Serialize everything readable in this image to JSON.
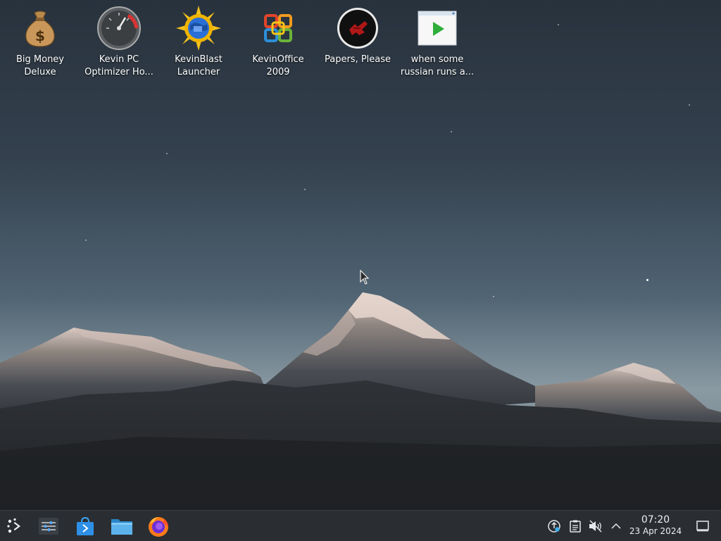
{
  "desktop": {
    "icons": [
      {
        "label": "Big Money\nDeluxe",
        "icon": "money-bag-icon"
      },
      {
        "label": "Kevin PC\nOptimizer Ho...",
        "icon": "speedometer-icon"
      },
      {
        "label": "KevinBlast\nLauncher",
        "icon": "globe-sun-icon"
      },
      {
        "label": "KevinOffice\n2009",
        "icon": "office-logo-icon"
      },
      {
        "label": "Papers, Please",
        "icon": "arstotzka-emblem-icon"
      },
      {
        "label": "when some\nrussian runs a...",
        "icon": "video-play-icon"
      }
    ]
  },
  "taskbar": {
    "launcher_icon": "app-launcher-icon",
    "pinned": [
      {
        "name": "system-settings",
        "icon": "settings-sliders-icon"
      },
      {
        "name": "discover",
        "icon": "store-bag-icon"
      },
      {
        "name": "file-manager",
        "icon": "folder-icon"
      },
      {
        "name": "firefox",
        "icon": "firefox-icon"
      }
    ],
    "tray": [
      {
        "name": "network",
        "icon": "network-icon"
      },
      {
        "name": "clipboard",
        "icon": "clipboard-icon"
      },
      {
        "name": "volume",
        "icon": "volume-muted-icon"
      },
      {
        "name": "expand",
        "icon": "chevron-up-icon"
      }
    ],
    "clock": {
      "time": "07:20",
      "date": "23 Apr 2024"
    },
    "show_desktop_icon": "show-desktop-icon"
  },
  "colors": {
    "sky_top": "#28323d",
    "sky_horizon": "#8a9aa3",
    "taskbar_bg": "#2a2e32",
    "label_text": "#ffffff"
  }
}
